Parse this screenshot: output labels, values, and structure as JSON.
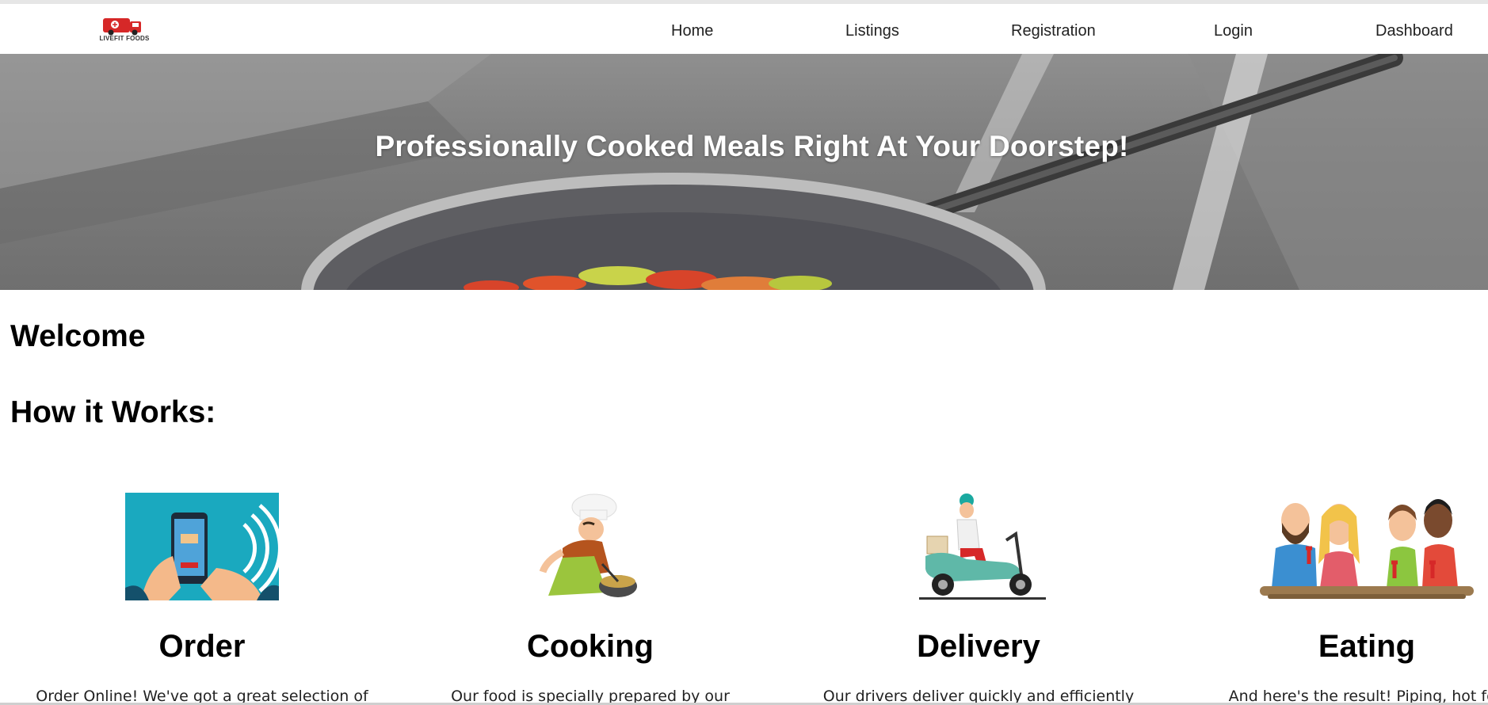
{
  "brand": {
    "logo_text": "LIVEFIT FOODS",
    "accent": "#d62828"
  },
  "nav": {
    "items": [
      {
        "label": "Home"
      },
      {
        "label": "Listings"
      },
      {
        "label": "Registration"
      },
      {
        "label": "Login"
      },
      {
        "label": "Dashboard"
      }
    ]
  },
  "hero": {
    "title": "Professionally Cooked Meals Right At Your Doorstep!"
  },
  "main": {
    "welcome": "Welcome",
    "how_it_works": "How it Works:"
  },
  "steps": [
    {
      "title": "Order",
      "desc": "Order Online! We've got a great selection of",
      "icon": "phone-order-icon"
    },
    {
      "title": "Cooking",
      "desc": "Our food is specially prepared by our",
      "icon": "chef-icon"
    },
    {
      "title": "Delivery",
      "desc": "Our drivers deliver quickly and efficiently",
      "icon": "scooter-delivery-icon"
    },
    {
      "title": "Eating",
      "desc": "And here's the result! Piping, hot foo",
      "icon": "people-eating-icon"
    }
  ]
}
